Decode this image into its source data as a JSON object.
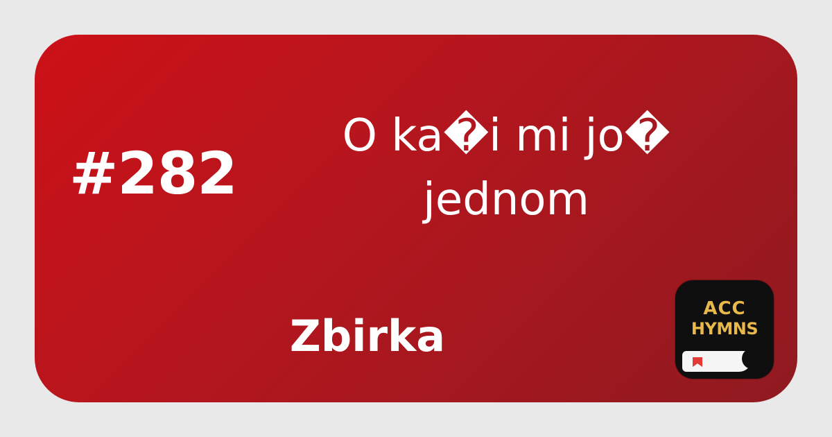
{
  "hymn": {
    "number": "#282",
    "title_lines": [
      "O ka�i mi jo�",
      "jednom"
    ],
    "collection": "Zbirka"
  },
  "app_logo": {
    "line1": "ACC",
    "line2": "HYMNS",
    "icon": "bookmark-icon"
  },
  "colors": {
    "page_background": "#e9e9e9",
    "card_gradient_start": "#cc1117",
    "card_gradient_end": "#8f1a20",
    "text": "#ffffff",
    "logo_background": "#0f0f0f",
    "logo_text": "#e8b84a",
    "bookmark": "#e53935"
  }
}
